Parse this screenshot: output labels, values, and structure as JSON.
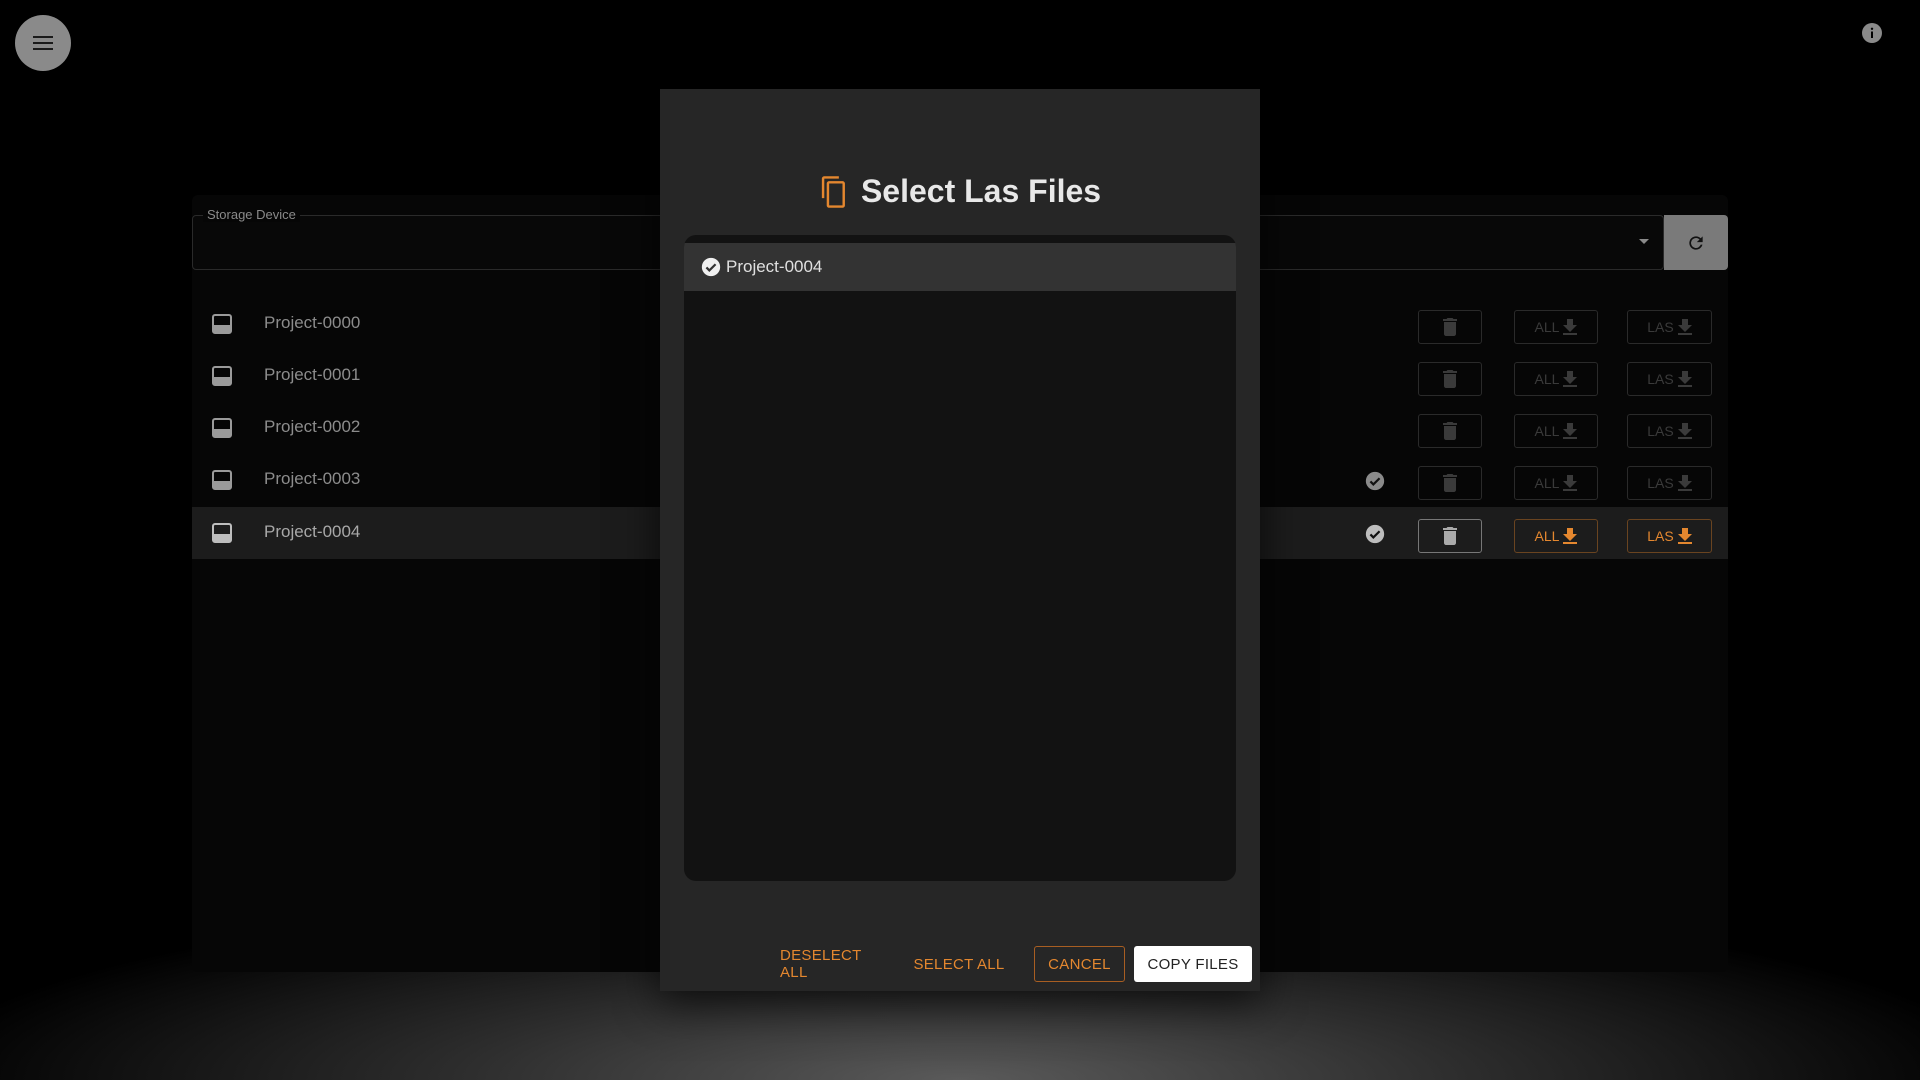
{
  "storage": {
    "label": "Storage Device",
    "value": ""
  },
  "projects": [
    {
      "name": "Project-0000",
      "status": false,
      "active": false
    },
    {
      "name": "Project-0001",
      "status": false,
      "active": false
    },
    {
      "name": "Project-0002",
      "status": false,
      "active": false
    },
    {
      "name": "Project-0003",
      "status": true,
      "active": false
    },
    {
      "name": "Project-0004",
      "status": true,
      "active": true
    }
  ],
  "row_buttons": {
    "all_label": "ALL",
    "las_label": "LAS"
  },
  "modal": {
    "title": "Select Las Files",
    "files": [
      {
        "name": "Project-0004",
        "selected": true
      }
    ],
    "deselect_all": "DESELECT ALL",
    "select_all": "SELECT ALL",
    "cancel": "CANCEL",
    "copy_files": "COPY FILES"
  },
  "colors": {
    "accent": "#e4872f",
    "modal_bg": "#262626",
    "list_bg": "#121212"
  }
}
